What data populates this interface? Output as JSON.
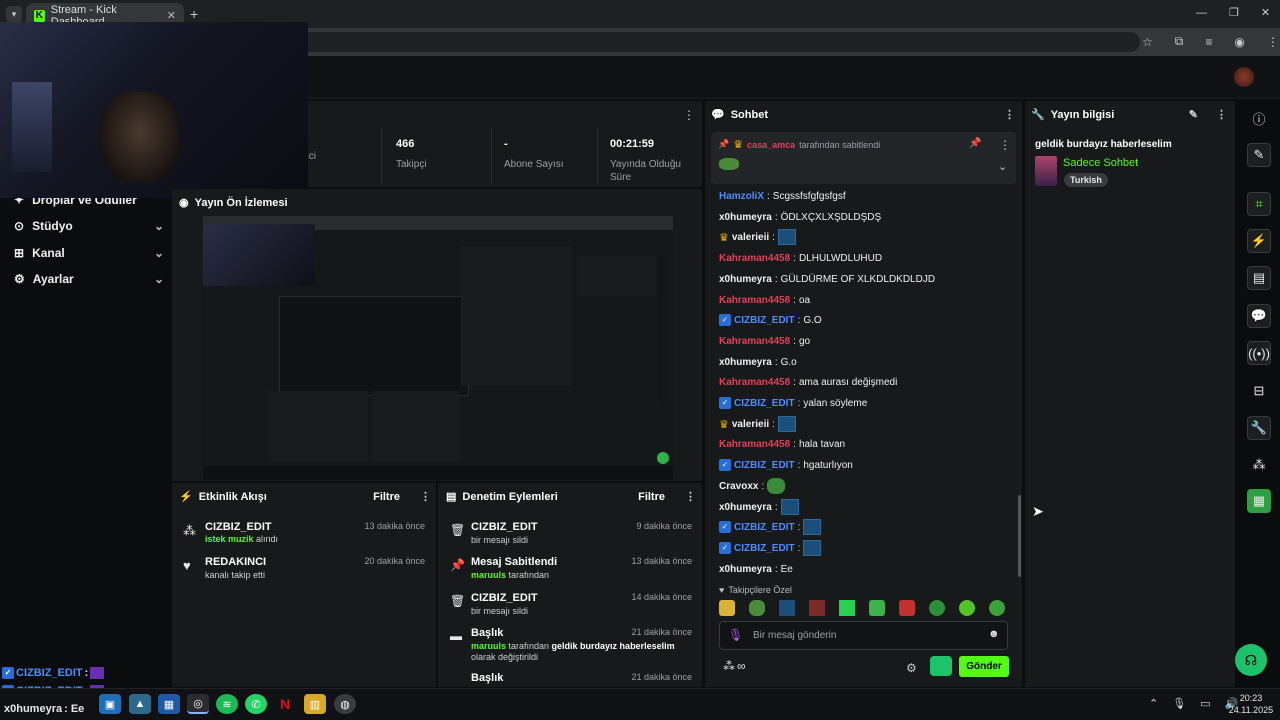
{
  "browser": {
    "tab_title": "Stream - Kick Dashboard",
    "tab_icon": "K",
    "new_tab": "+"
  },
  "sidebar": {
    "items": [
      {
        "label": "Droplar ve Ödüller"
      },
      {
        "label": "Stüdyo"
      },
      {
        "label": "Kanal"
      },
      {
        "label": "Ayarlar"
      }
    ]
  },
  "stats": [
    {
      "value": "",
      "label": "İzleyici"
    },
    {
      "value": "466",
      "label": "Takipçi"
    },
    {
      "value": "-",
      "label": "Abone Sayısı"
    },
    {
      "value": "00:21:59",
      "label": "Yayında Olduğu Süre"
    }
  ],
  "preview": {
    "title": "Yayın Ön İzlemesi"
  },
  "activity": {
    "title": "Etkinlik Akışı",
    "filter": "Filtre",
    "items": [
      {
        "title": "CIZBIZ_EDIT",
        "highlight": "istek muzik",
        "rest": " alındı",
        "time": "13 dakika önce"
      },
      {
        "title": "REDAKINCI",
        "highlight": "",
        "rest": "kanalı takip etti",
        "time": "20 dakika önce"
      }
    ]
  },
  "moderation": {
    "title": "Denetim Eylemleri",
    "filter": "Filtre",
    "items": [
      {
        "title": "CIZBIZ_EDIT",
        "highlight": "",
        "rest": "bir mesajı sildi",
        "time": "9 dakika önce"
      },
      {
        "title": "Mesaj Sabitlendi",
        "highlight": "maruuls",
        "rest": " tarafından",
        "time": "13 dakika önce"
      },
      {
        "title": "CIZBIZ_EDIT",
        "highlight": "",
        "rest": "bir mesajı sildi",
        "time": "14 dakika önce"
      },
      {
        "title": "Başlık",
        "highlight": "maruuls",
        "rest": " tarafından",
        "bold": " geldik burdayız haberleselim",
        "rest2": " olarak değiştirildi",
        "time": "21 dakika önce"
      },
      {
        "title": "Başlık",
        "highlight": "",
        "rest": "",
        "time": "21 dakika önce"
      }
    ]
  },
  "chat": {
    "title": "Sohbet",
    "pinned": {
      "user": "casa_amca",
      "text": "tarafından sabitlendi"
    },
    "messages": [
      {
        "user": "HamzoliX",
        "color": "blue",
        "badge": "",
        "text": "Scgssfsfgfgsfgsf",
        "emote": false
      },
      {
        "user": "x0humeyra",
        "color": "white",
        "badge": "",
        "text": "ÖDLXÇXLXŞDLDŞDŞ",
        "emote": false
      },
      {
        "user": "valerieii",
        "color": "white",
        "badge": "crown",
        "text": "",
        "emote": true
      },
      {
        "user": "Kahraman4458",
        "color": "red",
        "badge": "",
        "text": "DLHULWDLUHUD",
        "emote": false
      },
      {
        "user": "x0humeyra",
        "color": "white",
        "badge": "",
        "text": "GÜLDÜRME OF XLKDLDKDLDJD",
        "emote": false
      },
      {
        "user": "Kahraman4458",
        "color": "red",
        "badge": "",
        "text": "oa",
        "emote": false
      },
      {
        "user": "CIZBIZ_EDIT",
        "color": "blue",
        "badge": "verified",
        "text": "G.O",
        "emote": false
      },
      {
        "user": "Kahraman4458",
        "color": "red",
        "badge": "",
        "text": "go",
        "emote": false
      },
      {
        "user": "x0humeyra",
        "color": "white",
        "badge": "",
        "text": "G.o",
        "emote": false
      },
      {
        "user": "Kahraman4458",
        "color": "red",
        "badge": "",
        "text": "ama aurası değişmedi",
        "emote": false
      },
      {
        "user": "CIZBIZ_EDIT",
        "color": "blue",
        "badge": "verified",
        "text": "yalan söyleme",
        "emote": false
      },
      {
        "user": "valerieii",
        "color": "white",
        "badge": "crown",
        "text": "",
        "emote": true
      },
      {
        "user": "Kahraman4458",
        "color": "red",
        "badge": "",
        "text": "hala tavan",
        "emote": false
      },
      {
        "user": "CIZBIZ_EDIT",
        "color": "blue",
        "badge": "verified",
        "text": "hgaturlıyon",
        "emote": false
      },
      {
        "user": "Cravoxx",
        "color": "white",
        "badge": "",
        "text": "",
        "emote": true
      },
      {
        "user": "x0humeyra",
        "color": "white",
        "badge": "",
        "text": "",
        "emote": true
      },
      {
        "user": "CIZBIZ_EDIT",
        "color": "blue",
        "badge": "verified",
        "text": "",
        "emote": true
      },
      {
        "user": "CIZBIZ_EDIT",
        "color": "blue",
        "badge": "verified",
        "text": "",
        "emote": true
      },
      {
        "user": "x0humeyra",
        "color": "white",
        "badge": "",
        "text": "Ee",
        "emote": false
      }
    ],
    "followers_only": "Takipçilere Özel",
    "input_placeholder": "Bir mesaj gönderin",
    "send": "Gönder",
    "infinity": "∞"
  },
  "stream_info": {
    "title": "Yayın bilgisi",
    "stream_title": "geldik burdayız haberleselim",
    "category": "Sadece Sohbet",
    "tag": "Turkish"
  },
  "overlay_chat": [
    {
      "user": "CIZBIZ_EDIT",
      "text": ":"
    },
    {
      "user": "CIZBIZ_EDIT",
      "text": ":"
    },
    {
      "user": "x0humeyra",
      "text": ": Ee"
    }
  ],
  "taskbar": {
    "time": "20:23",
    "date": "24.11.2025"
  }
}
